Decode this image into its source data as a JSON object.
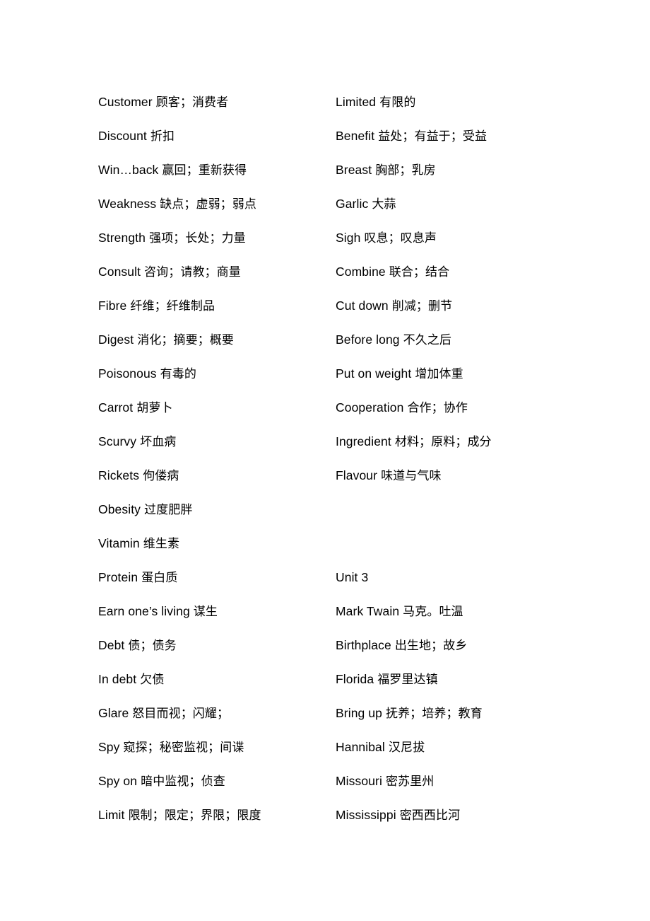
{
  "document": {
    "background_color": "#ffffff",
    "text_color": "#000000",
    "columns": {
      "left": [
        {
          "term": "Customer",
          "gloss": "顾客；消费者"
        },
        {
          "term": "Discount",
          "gloss": "折扣"
        },
        {
          "term": "Win…back",
          "gloss": "赢回；重新获得"
        },
        {
          "term": "Weakness",
          "gloss": "缺点；虚弱；弱点"
        },
        {
          "term": "Strength",
          "gloss": "强项；长处；力量"
        },
        {
          "term": "Consult",
          "gloss": "咨询；请教；商量"
        },
        {
          "term": "Fibre",
          "gloss": "纤维；纤维制品"
        },
        {
          "term": "Digest",
          "gloss": "消化；摘要；概要"
        },
        {
          "term": "Poisonous",
          "gloss": "有毒的"
        },
        {
          "term": "Carrot",
          "gloss": "胡萝卜"
        },
        {
          "term": "Scurvy",
          "gloss": "坏血病"
        },
        {
          "term": "Rickets",
          "gloss": "佝偻病"
        },
        {
          "term": "Obesity",
          "gloss": "过度肥胖"
        },
        {
          "term": "Vitamin",
          "gloss": "维生素"
        },
        {
          "term": "Protein",
          "gloss": "蛋白质"
        },
        {
          "term": "Earn one’s living",
          "gloss": "谋生"
        },
        {
          "term": "Debt",
          "gloss": "债；债务"
        },
        {
          "term": "In debt",
          "gloss": "欠债"
        },
        {
          "term": "Glare",
          "gloss": "怒目而视；闪耀；"
        },
        {
          "term": "Spy",
          "gloss": "窥探；秘密监视；间谍"
        },
        {
          "term": "Spy on",
          "gloss": "暗中监视；侦查"
        },
        {
          "term": "Limit",
          "gloss": "限制；限定；界限；限度"
        }
      ],
      "right": [
        {
          "term": "Limited",
          "gloss": "有限的"
        },
        {
          "term": "Benefit",
          "gloss": "益处；有益于；受益"
        },
        {
          "term": "Breast",
          "gloss": "胸部；乳房"
        },
        {
          "term": "Garlic",
          "gloss": "大蒜"
        },
        {
          "term": "Sigh",
          "gloss": "叹息；叹息声"
        },
        {
          "term": "Combine",
          "gloss": "联合；结合"
        },
        {
          "term": "Cut down",
          "gloss": "削减；删节"
        },
        {
          "term": "Before long",
          "gloss": "不久之后"
        },
        {
          "term": "Put on weight",
          "gloss": "增加体重"
        },
        {
          "term": "Cooperation",
          "gloss": "合作；协作"
        },
        {
          "term": "Ingredient",
          "gloss": "材料；原料；成分"
        },
        {
          "term": "Flavour",
          "gloss": "味道与气味"
        },
        {
          "term": "",
          "gloss": ""
        },
        {
          "term": "",
          "gloss": ""
        },
        {
          "term": "Unit 3",
          "gloss": ""
        },
        {
          "term": "Mark Twain",
          "gloss": "马克。吐温"
        },
        {
          "term": "Birthplace",
          "gloss": "出生地；故乡"
        },
        {
          "term": "Florida",
          "gloss": "福罗里达镇"
        },
        {
          "term": "Bring up",
          "gloss": "抚养；培养；教育"
        },
        {
          "term": "Hannibal",
          "gloss": "汉尼拔"
        },
        {
          "term": "Missouri",
          "gloss": "密苏里州"
        },
        {
          "term": "Mississippi",
          "gloss": "密西西比河"
        }
      ]
    }
  }
}
